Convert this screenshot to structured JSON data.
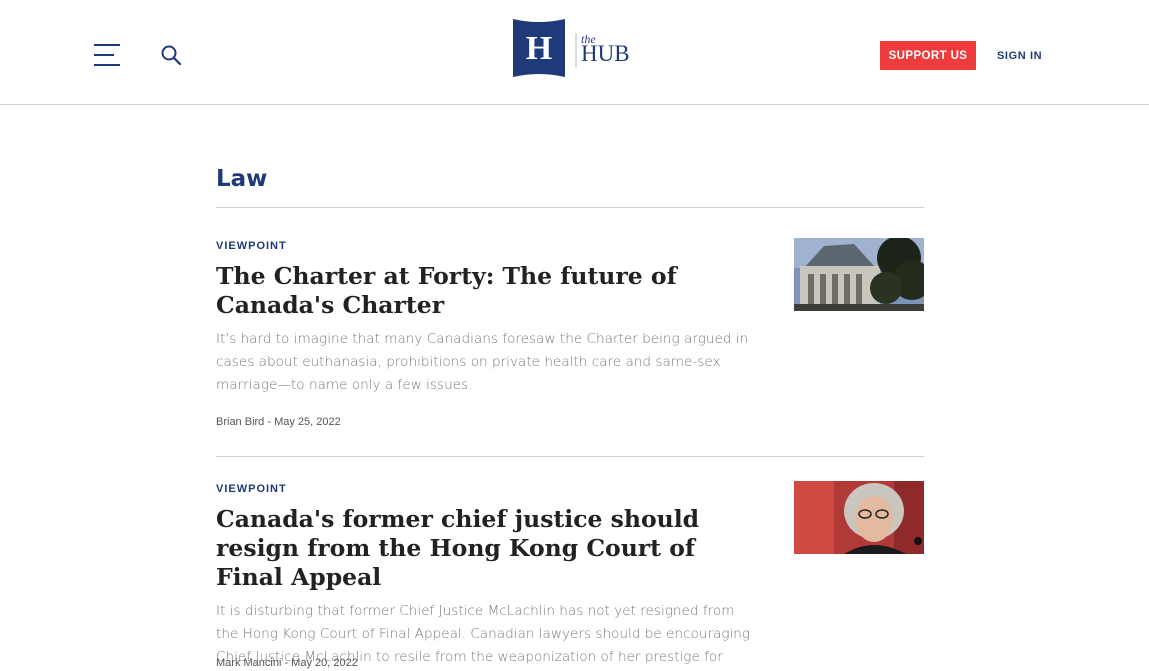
{
  "header": {
    "logo_small": "the",
    "logo_large": "HUB",
    "logo_letter": "H",
    "support_label": "SUPPORT US",
    "signin_label": "SIGN IN"
  },
  "colors": {
    "brand_navy": "#1e3a7a",
    "support_red": "#ee3b3b",
    "rule_gray": "#cfcfcf",
    "excerpt_gray": "#7a7a7a"
  },
  "icons": [
    "menu-icon",
    "search-icon"
  ],
  "section": {
    "title": "Law"
  },
  "articles": [
    {
      "kicker": "VIEWPOINT",
      "headline": "The Charter at Forty: The future of Canada's Charter",
      "excerpt": "It's hard to imagine that many Canadians foresaw the Charter being argued in cases about euthanasia, prohibitions on private health care and same-sex marriage—to name only a few issues.",
      "byline": "Brian Bird - May 25, 2022"
    },
    {
      "kicker": "VIEWPOINT",
      "headline": "Canada's former chief justice should resign from the Hong Kong Court of Final Appeal",
      "excerpt": "It is disturbing that former Chief Justice McLachlin has not yet resigned from the Hong Kong Court of Final Appeal. Canadian lawyers should be encouraging Chief Justice McLachlin to resile from the weaponization of her prestige for China's ends.",
      "byline": "Mark Mancini - May 20, 2022"
    }
  ]
}
